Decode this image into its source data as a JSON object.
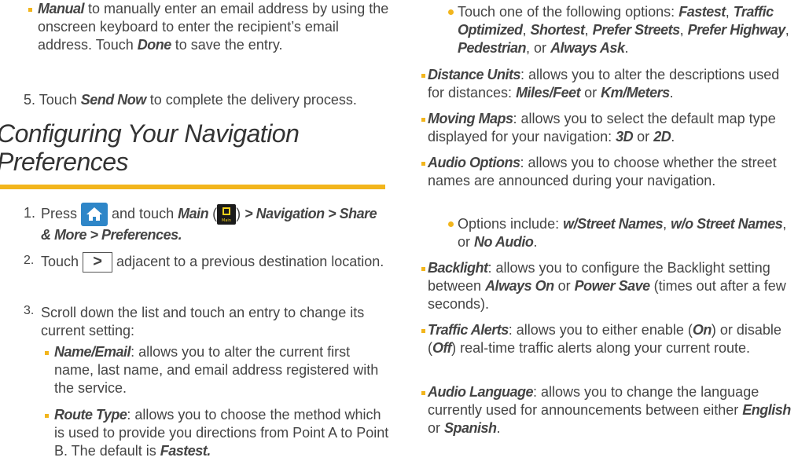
{
  "left": {
    "manual_bullet": {
      "kw": "Manual",
      "text1": " to manually enter an email address by using the onscreen keyboard to enter the recipient’s email address. Touch ",
      "kw2": "Done",
      "text2": " to save the entry."
    },
    "step5": {
      "num": "5.",
      "text1": "Touch ",
      "kw": "Send Now",
      "text2": " to complete the delivery process."
    },
    "heading": {
      "line1": "Configuring Your Navigation",
      "line2": "Preferences"
    },
    "step1": {
      "num": "1.",
      "press": "Press ",
      "and_touch": " and touch ",
      "main_kw": "Main",
      "paren_open": " (",
      "main_icon_label": "Main",
      "paren_close": ") ",
      "path": "> Navigation > Share & More > Preferences."
    },
    "step2": {
      "num": "2.",
      "touch": "Touch ",
      "next_glyph": ">",
      "rest": " adjacent to a previous destination location."
    },
    "step3": {
      "num": "3.",
      "text": "Scroll down the list and touch an entry to change its current setting:"
    },
    "name_email": {
      "kw": "Name/Email",
      "text": ": allows you to alter the current first name, last name, and email address registered with the service."
    },
    "route_type": {
      "kw": "Route Type",
      "text": ": allows you to choose the method which is used to provide you directions from Point A to Point B. The default is ",
      "kw2": "Fastest."
    }
  },
  "right": {
    "route_opts": {
      "t1": "Touch one of the following options: ",
      "o1": "Fastest",
      "c1": ", ",
      "o2": "Traffic Optimized",
      "c2": ", ",
      "o3": "Shortest",
      "c3": ", ",
      "o4": "Prefer Streets",
      "c4": ", ",
      "o5": "Prefer Highway",
      "c5": ", ",
      "o6": "Pedestrian",
      "c6": ", or ",
      "o7": "Always Ask",
      "end": "."
    },
    "distance": {
      "kw": "Distance Units",
      "t1": ": allows you to alter the descriptions used for distances: ",
      "o1": "Miles/Feet",
      "t2": " or ",
      "o2": "Km/Meters",
      "end": "."
    },
    "moving": {
      "kw": "Moving Maps",
      "t1": ": allows you to select the default map type displayed for your navigation: ",
      "o1": "3D",
      "t2": " or ",
      "o2": "2D",
      "end": "."
    },
    "audio_opt": {
      "kw": "Audio Options",
      "t1": ": allows you to choose whether the street names are announced during your navigation."
    },
    "audio_sub": {
      "t1": "Options include: ",
      "o1": "w/Street Names",
      "c1": ", ",
      "o2": "w/o Street Names",
      "c2": ", or ",
      "o3": "No Audio",
      "end": "."
    },
    "backlight": {
      "kw": "Backlight",
      "t1": ": allows you to configure the Backlight setting between ",
      "o1": "Always On",
      "t2": " or ",
      "o2": "Power Save",
      "t3": " (times out after a few seconds)."
    },
    "traffic": {
      "kw": "Traffic Alerts",
      "t1": ": allows you to either enable (",
      "o1": "On",
      "t2": ") or disable (",
      "o2": "Off",
      "t3": ") real-time traffic alerts along your current route."
    },
    "language": {
      "kw": "Audio Language",
      "t1": ": allows you to change the language currently used for announcements between either ",
      "o1": "English",
      "t2": " or ",
      "o2": "Spanish",
      "end": "."
    }
  },
  "colors": {
    "accent": "#f2b51c",
    "text": "#444444",
    "home_button": "#2e86c8"
  }
}
